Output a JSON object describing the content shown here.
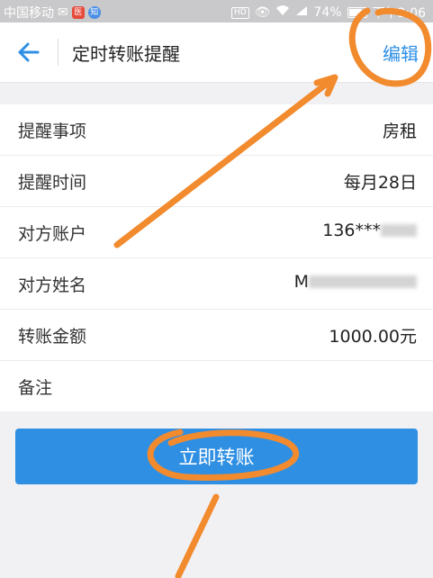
{
  "status_bar": {
    "carrier": "中国移动",
    "app_badge": "医",
    "badge2": "知",
    "hd": "HD",
    "battery": "74%",
    "time": "下午3:06"
  },
  "header": {
    "title": "定时转账提醒",
    "edit_label": "编辑"
  },
  "details": [
    {
      "label": "提醒事项",
      "value": "房租"
    },
    {
      "label": "提醒时间",
      "value": "每月28日"
    },
    {
      "label": "对方账户",
      "value": "136***"
    },
    {
      "label": "对方姓名",
      "value": "M"
    },
    {
      "label": "转账金额",
      "value": "1000.00元"
    },
    {
      "label": "备注",
      "value": ""
    }
  ],
  "action_button": "立即转账",
  "colors": {
    "accent": "#2f8fe3",
    "annotation": "#f28a2e"
  }
}
